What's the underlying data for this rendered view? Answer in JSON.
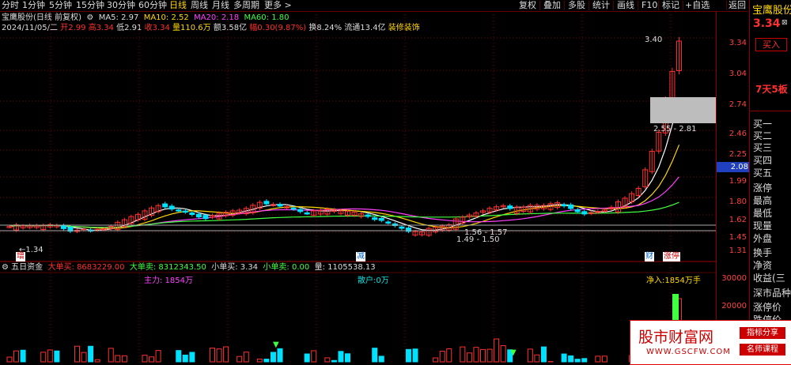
{
  "toolbar": {
    "periods": [
      "分时",
      "1分钟",
      "5分钟",
      "15分钟",
      "30分钟",
      "60分钟",
      "日线",
      "周线",
      "月线",
      "多周期",
      "更多 >"
    ],
    "active_period": "日线",
    "tools": [
      "复权",
      "叠加",
      "多股",
      "统计",
      "画线",
      "F10",
      "标记",
      "+自选",
      "返回"
    ]
  },
  "info1": {
    "name": "宝鹰股份(日线 前复权)",
    "ma5": "MA5: 2.97",
    "ma10": "MA10: 2.52",
    "ma20": "MA20: 2.18",
    "ma60": "MA60: 1.80"
  },
  "info2": {
    "date": "2024/11/05/二",
    "open": "开2.99",
    "high": "高3.34",
    "low": "低2.91",
    "close": "收3.34",
    "vol": "量110.6万",
    "amount": "额3.58亿",
    "change": "幅0.30(9.87%)",
    "turnover": "换8.24%",
    "float": "流通13.4亿",
    "sector": "装修装饰"
  },
  "price_axis": [
    "3.34",
    "3.04",
    "2.74",
    "2.46",
    "2.25",
    "1.99",
    "1.80",
    "1.62",
    "1.45",
    "1.31"
  ],
  "current_price_marker": "2.08",
  "annotations": {
    "high_label": "3.40",
    "low_label": "1.34",
    "range_label": "2.55 - 2.81",
    "mid_label": "1.56 - 1.57",
    "mid_label2": "1.49 - 1.50",
    "tag_zeng": "增",
    "tag_jian": "减",
    "tag_cai": "财",
    "tag_zhangting": "涨停"
  },
  "indicator": {
    "name": "五日资金",
    "big_buy": "大单买: 8683229.00",
    "big_sell": "大单卖: 8312343.50",
    "small_buy": "小单买: 3.34",
    "small_sell": "小单卖: 0.00",
    "vol": "量: 1105538.13",
    "main_force": "主力: 1854万",
    "retail": "散户:0万",
    "net_in": "净入:1854万手",
    "axis": [
      "30000",
      "20000"
    ]
  },
  "right_panel": {
    "stock_name": "宝鹰股份",
    "price": "3.34",
    "buy_btn": "买入",
    "board": "7天5板",
    "rows": [
      "买一",
      "买二",
      "买三",
      "买四",
      "买五",
      "涨停",
      "最高",
      "最低",
      "现量",
      "外盘",
      "换手",
      "净资",
      "收益(三",
      "深市品种",
      "涨停价",
      "跌停价"
    ]
  },
  "watermark": {
    "title": "股市财富网",
    "url": "WWW.GSCFW.COM",
    "tag1": "指标分享",
    "tag2": "名师课程"
  },
  "colors": {
    "up": "#ff3030",
    "down": "#00e0ff",
    "ma5": "#ffffff",
    "ma10": "#ffd700",
    "ma20": "#ff40ff",
    "ma60": "#40ff40"
  }
}
